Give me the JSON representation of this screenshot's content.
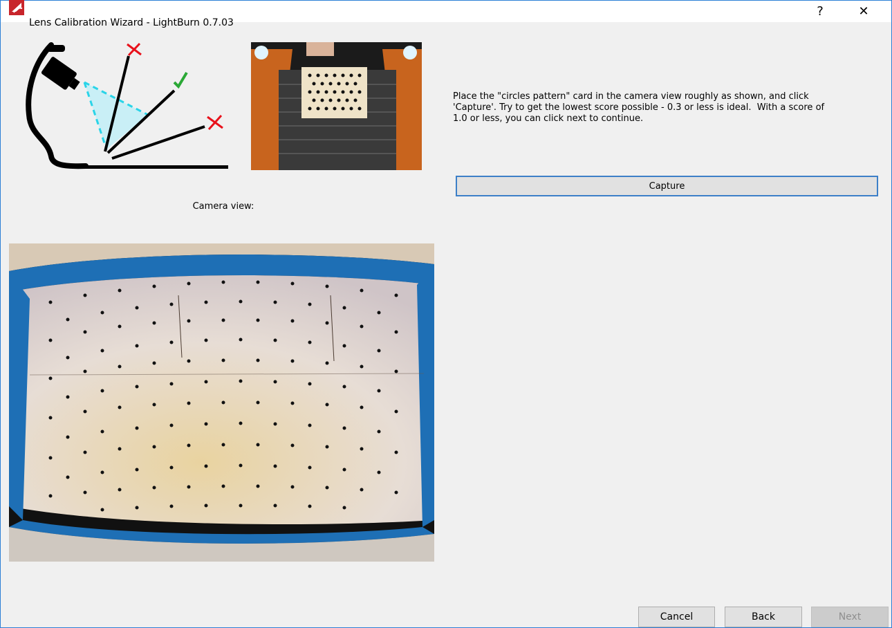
{
  "window": {
    "title": "Lens Calibration Wizard - LightBurn 0.7.03",
    "help_label": "?",
    "close_label": "✕"
  },
  "instructions": "Place the \"circles pattern\" card in the camera view roughly as shown, and click\n'Capture'. Try to get the lowest score possible - 0.3 or less is ideal.  With a score of\n1.0 or less, you can click next to continue.",
  "capture_label": "Capture",
  "camera_view_label": "Camera view:",
  "footer": {
    "cancel_label": "Cancel",
    "back_label": "Back",
    "next_label": "Next"
  },
  "colors": {
    "accent": "#3c7fc8",
    "cross": "#e8111b",
    "check": "#2aa836",
    "camera_rail": "#1e6fb5"
  }
}
